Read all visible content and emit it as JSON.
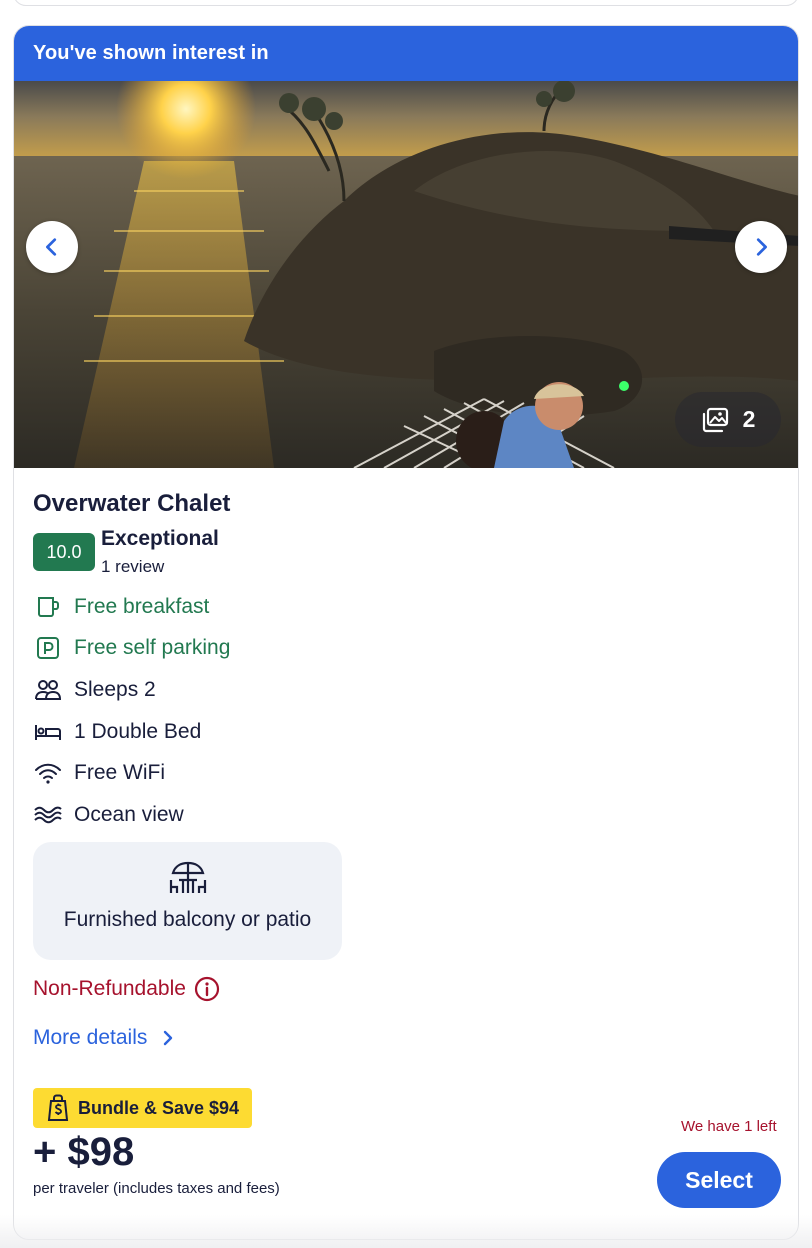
{
  "banner": {
    "text": "You've shown interest in"
  },
  "gallery": {
    "photo_count": "2",
    "prev_icon": "chevron-left-icon",
    "next_icon": "chevron-right-icon",
    "count_icon": "photo-gallery-icon"
  },
  "room": {
    "name": "Overwater Chalet",
    "rating_score": "10.0",
    "rating_word": "Exceptional",
    "review_count": "1 review"
  },
  "amenities": [
    {
      "label": "Free breakfast",
      "icon": "coffee-cup-icon",
      "highlight": true
    },
    {
      "label": "Free self parking",
      "icon": "parking-icon",
      "highlight": true
    },
    {
      "label": "Sleeps 2",
      "icon": "people-icon",
      "highlight": false
    },
    {
      "label": "1 Double Bed",
      "icon": "bed-icon",
      "highlight": false
    },
    {
      "label": "Free WiFi",
      "icon": "wifi-icon",
      "highlight": false
    },
    {
      "label": "Ocean view",
      "icon": "waves-icon",
      "highlight": false
    }
  ],
  "feature": {
    "label": "Furnished balcony or patio",
    "icon": "patio-table-icon"
  },
  "policy": {
    "label": "Non-Refundable",
    "icon": "info-icon"
  },
  "more_details": {
    "label": "More details"
  },
  "pricing": {
    "bundle_label": "Bundle & Save $94",
    "price": "+ $98",
    "price_note": "per traveler (includes taxes and fees)",
    "scarcity": "We have 1 left",
    "select_label": "Select"
  },
  "colors": {
    "brand_blue": "#2b63dd",
    "green": "#227950",
    "alert_red": "#a6122d",
    "bundle_yellow": "#fddb32",
    "text_dark": "#191e3b"
  }
}
